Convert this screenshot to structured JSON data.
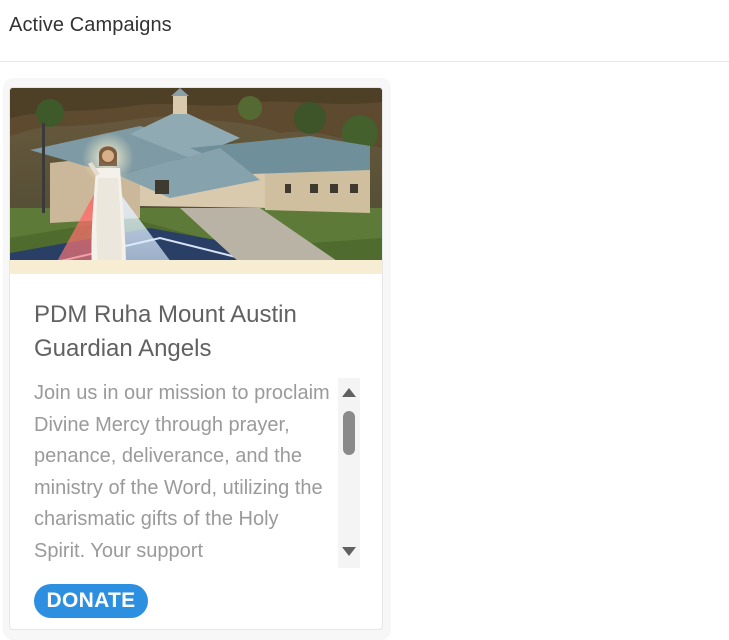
{
  "header": {
    "title": "Active Campaigns"
  },
  "campaign": {
    "image_alt": "Aerial view of the church building with Divine Mercy image",
    "title": "PDM Ruha Mount Austin Guardian Angels",
    "description": "Join us in our mission to proclaim Divine Mercy through prayer, penance, deliverance, and the ministry of the Word, utilizing the charismatic gifts of the Holy Spirit. Your support",
    "donate_label": "DONATE"
  },
  "colors": {
    "accent": "#2d8fe0",
    "title_text": "#616161",
    "body_text": "#9a9a9a"
  }
}
